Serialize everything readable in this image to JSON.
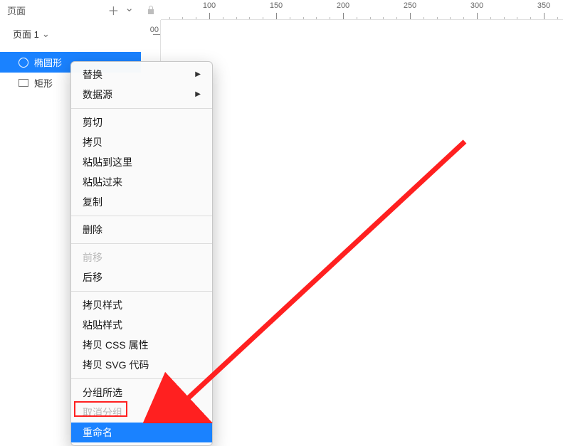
{
  "panel": {
    "title": "页面",
    "plus": "＋",
    "chevron": "⌄"
  },
  "page_row": {
    "label": "页面 1",
    "chevron": "⌄"
  },
  "layers": [
    {
      "name": "椭圆形",
      "selected": true,
      "shape": "ellipse"
    },
    {
      "name": "矩形",
      "selected": false,
      "shape": "rect"
    }
  ],
  "ruler": {
    "labels": [
      "100",
      "150",
      "200",
      "250",
      "300",
      "350"
    ],
    "v_label": "00"
  },
  "menu": {
    "items": [
      {
        "label": "替换",
        "arrow": true
      },
      {
        "label": "数据源",
        "arrow": true
      },
      {
        "sep": true
      },
      {
        "label": "剪切"
      },
      {
        "label": "拷贝"
      },
      {
        "label": "粘贴到这里"
      },
      {
        "label": "粘贴过来"
      },
      {
        "label": "复制"
      },
      {
        "sep": true
      },
      {
        "label": "删除"
      },
      {
        "sep": true
      },
      {
        "label": "前移",
        "disabled": true
      },
      {
        "label": "后移"
      },
      {
        "sep": true
      },
      {
        "label": "拷贝样式"
      },
      {
        "label": "粘贴样式"
      },
      {
        "label": "拷贝 CSS 属性"
      },
      {
        "label": "拷贝 SVG 代码"
      },
      {
        "sep": true
      },
      {
        "label": "分组所选"
      },
      {
        "label": "取消分组",
        "disabled": true
      },
      {
        "label": "重命名",
        "highlight": true
      }
    ]
  }
}
